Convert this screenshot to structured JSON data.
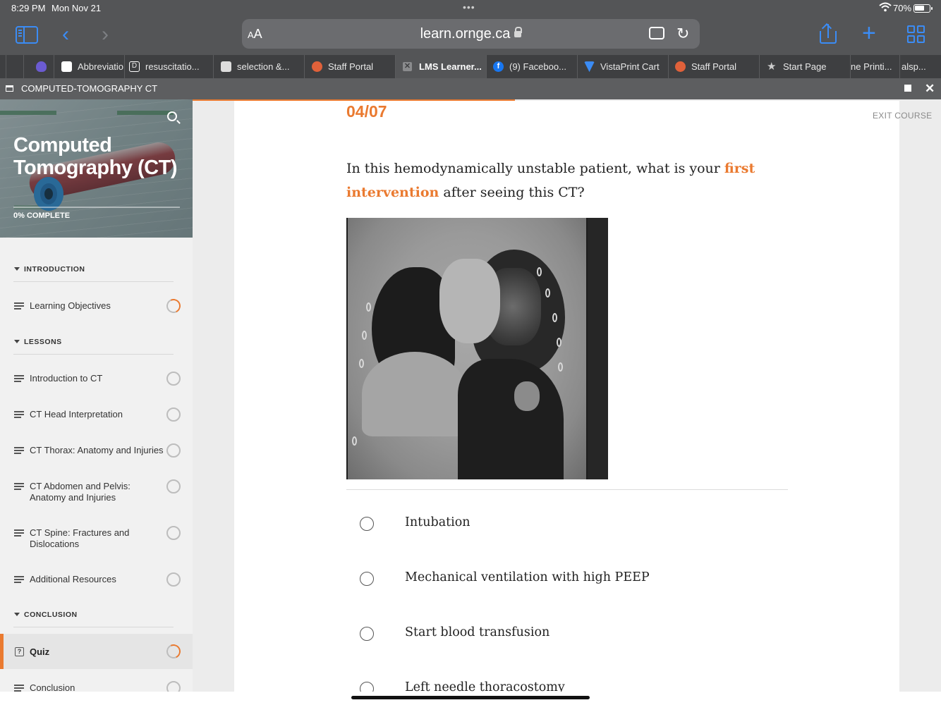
{
  "status": {
    "time": "8:29 PM",
    "date": "Mon Nov 21",
    "battery_pct": "70%",
    "battery_level": 0.7
  },
  "browser": {
    "aa_small": "A",
    "aa_big": "A",
    "url": "learn.ornge.ca",
    "tabs": [
      {
        "label": "",
        "favicon_color": "#6b5bd1",
        "icon": "shield-icon"
      },
      {
        "label": "Abbreviatio",
        "favicon_color": "#ffffff",
        "icon": "app-icon"
      },
      {
        "label": "resuscitatio...",
        "favicon_color": "#3e3f41",
        "icon": "d-icon"
      },
      {
        "label": "selection &...",
        "favicon_color": "#dddddd",
        "icon": "doc-icon"
      },
      {
        "label": "Staff Portal",
        "favicon_color": "#e0613a",
        "icon": "portal-icon"
      },
      {
        "label": "LMS Learner...",
        "favicon_color": "#8a8b8d",
        "icon": "close-icon",
        "active": true
      },
      {
        "label": "(9) Faceboo...",
        "favicon_color": "#1877f2",
        "icon": "facebook-icon"
      },
      {
        "label": "VistaPrint Cart",
        "favicon_color": "#3b8cf5",
        "icon": "vistaprint-icon"
      },
      {
        "label": "Staff Portal",
        "favicon_color": "#e0613a",
        "icon": "portal-icon"
      },
      {
        "label": "Start Page",
        "favicon_color": "#cccccc",
        "icon": "star-icon"
      },
      {
        "label": "ne Printi...",
        "favicon_color": "",
        "icon": ""
      },
      {
        "label": "alsp...",
        "favicon_color": "",
        "icon": ""
      }
    ]
  },
  "window": {
    "title": "COMPUTED-TOMOGRAPHY CT"
  },
  "course": {
    "title": "Computed Tomography (CT)",
    "progress_label": "0% COMPLETE",
    "progress": 0,
    "sections": [
      {
        "label": "INTRODUCTION"
      },
      {
        "label": "LESSONS"
      },
      {
        "label": "CONCLUSION"
      }
    ],
    "lessons": [
      {
        "label": "Learning Objectives",
        "status": "in-progress"
      },
      {
        "label": "Introduction to CT",
        "status": "not-started"
      },
      {
        "label": "CT Head Interpretation",
        "status": "not-started"
      },
      {
        "label": "CT Thorax: Anatomy and Injuries",
        "status": "not-started"
      },
      {
        "label": "CT Abdomen and Pelvis: Anatomy and Injuries",
        "status": "not-started"
      },
      {
        "label": "CT Spine: Fractures and Dislocations",
        "status": "not-started"
      },
      {
        "label": "Additional Resources",
        "status": "not-started"
      },
      {
        "label": "Quiz",
        "status": "in-progress",
        "active": true
      },
      {
        "label": "Conclusion",
        "status": "not-started"
      }
    ]
  },
  "quiz": {
    "counter": "04/07",
    "exit_label": "EXIT COURSE",
    "question_pre": "In this hemodynamically unstable patient, what is your ",
    "question_highlight": "first intervention",
    "question_post": " after seeing this CT?",
    "options": [
      "Intubation",
      "Mechanical ventilation with high PEEP",
      "Start blood transfusion",
      "Left needle thoracostomy"
    ],
    "accent_color": "#ea7a30"
  }
}
